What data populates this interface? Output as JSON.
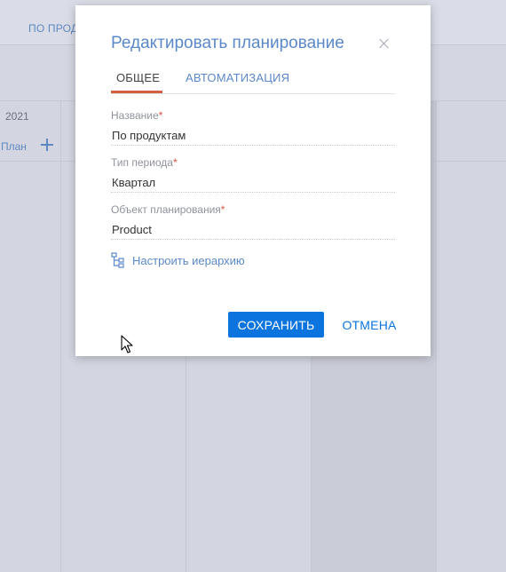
{
  "background": {
    "top_tab": "ПО ПРОД",
    "year": "2021",
    "plan_label": "План",
    "plus_icon": "plus-icon"
  },
  "modal": {
    "title": "Редактировать планирование",
    "close_icon": "close-icon",
    "tabs": [
      {
        "label": "ОБЩЕЕ",
        "active": true
      },
      {
        "label": "АВТОМАТИЗАЦИЯ",
        "active": false
      }
    ],
    "fields": [
      {
        "label": "Название",
        "required_mark": "*",
        "value": "По продуктам"
      },
      {
        "label": "Тип периода",
        "required_mark": "*",
        "value": "Квартал"
      },
      {
        "label": "Объект планирования",
        "required_mark": "*",
        "value": "Product"
      }
    ],
    "hierarchy_link": {
      "label": "Настроить иерархию",
      "icon": "hierarchy-icon"
    },
    "buttons": {
      "save": "СОХРАНИТЬ",
      "cancel": "ОТМЕНА"
    }
  },
  "colors": {
    "accent": "#0b74de",
    "title": "#5b88c9",
    "active_tab_underline": "#d35f3f",
    "required": "#d9533f"
  }
}
